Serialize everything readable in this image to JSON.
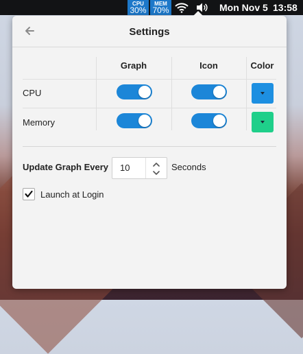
{
  "menubar": {
    "cpu": {
      "label": "CPU",
      "value": "30%"
    },
    "mem": {
      "label": "MEM",
      "value": "70%"
    },
    "wifi_icon": "wifi-icon",
    "volume_icon": "volume-icon",
    "date": "Mon Nov 5",
    "time": "13:58"
  },
  "panel": {
    "title": "Settings",
    "back_icon": "arrow-left-icon",
    "columns": [
      "Graph",
      "Icon",
      "Color"
    ],
    "rows": [
      {
        "label": "CPU",
        "graph_on": true,
        "icon_on": true,
        "color": "#1d8fe1"
      },
      {
        "label": "Memory",
        "graph_on": true,
        "icon_on": true,
        "color": "#1fcf8a"
      }
    ],
    "update": {
      "label": "Update Graph Every",
      "value": "10",
      "unit": "Seconds"
    },
    "launch_at_login": {
      "label": "Launch at Login",
      "checked": true
    }
  },
  "colors": {
    "accent": "#1c86d8",
    "cpu_stat_bg": "#1d78c9",
    "memory_swatch": "#1fcf8a",
    "cpu_swatch": "#1d8fe1"
  }
}
